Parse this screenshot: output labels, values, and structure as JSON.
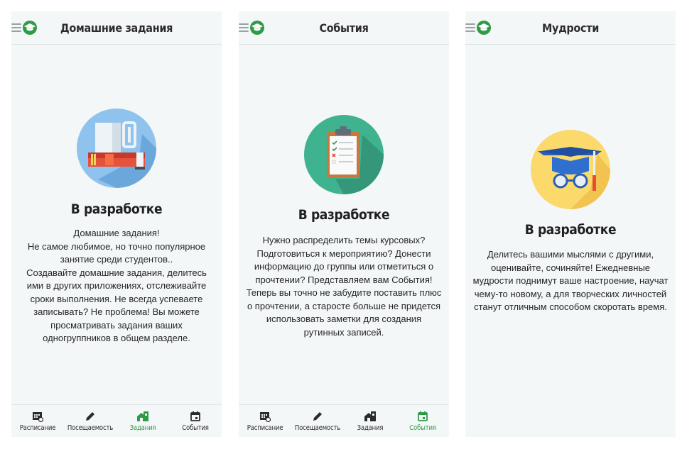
{
  "colors": {
    "accent": "#2e9b47",
    "background": "#f4f7f8",
    "text": "#262626"
  },
  "screens": [
    {
      "title": "Домашние задания",
      "heading": "В разработке",
      "description": "Домашние задания!\nНе самое любимое, но точно популярное занятие среди студентов..\nСоздавайте домашние задания, делитесь ими в других приложениях, отслеживайте сроки выполнения. Не всегда успеваете записывать? Не проблема! Вы можете просматривать задания ваших одногруппников в общем разделе.",
      "illustration": "mug-and-books"
    },
    {
      "title": "События",
      "heading": "В разработке",
      "description": "Нужно распределить темы курсовых? Подготовиться к мероприятию? Донести информацию до группы или отметиться о прочтении? Представляем вам События! Теперь вы точно не забудите поставить плюс о прочтении, а старосте больше не придется использовать заметки для создания рутинных записей.",
      "illustration": "clipboard-checklist"
    },
    {
      "title": "Мудрости",
      "heading": "В разработке",
      "description": "Делитесь вашими мыслями с другими, оценивайте, сочиняйте! Ежедневные мудрости поднимут ваше настроение, научат чему-то новому, а для творческих личностей станут отличным способом скоротать время.",
      "illustration": "graduation-cap-glasses"
    }
  ],
  "nav": {
    "items": [
      {
        "label": "Расписание",
        "icon": "calendar-grid-icon"
      },
      {
        "label": "Посещаемость",
        "icon": "pencil-icon"
      },
      {
        "label": "Задания",
        "icon": "home-task-icon"
      },
      {
        "label": "События",
        "icon": "event-calendar-icon"
      }
    ],
    "active_screen1": "Задания",
    "active_screen2": "События"
  }
}
